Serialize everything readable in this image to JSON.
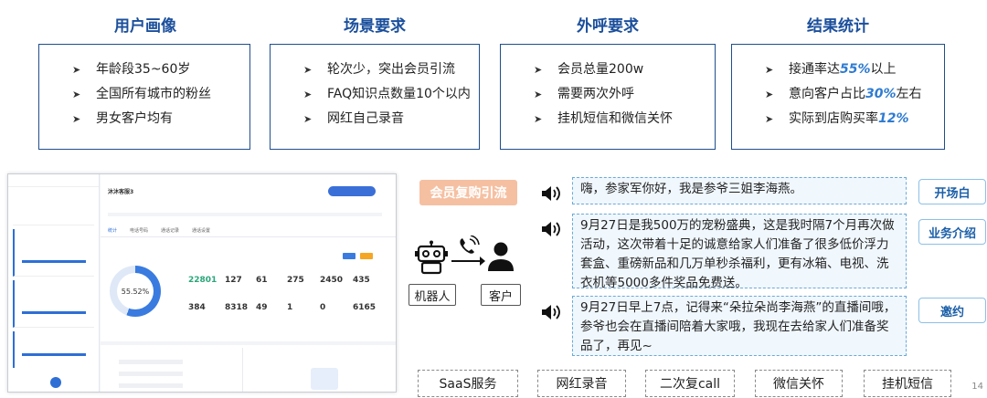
{
  "sections": [
    {
      "title": "用户画像",
      "items": [
        "年龄段35~60岁",
        "全国所有城市的粉丝",
        "男女客户均有"
      ]
    },
    {
      "title": "场景要求",
      "items": [
        "轮次少，突出会员引流",
        "FAQ知识点数量10个以内",
        "网红自己录音"
      ]
    },
    {
      "title": "外呼要求",
      "items": [
        "会员总量200w",
        "需要两次外呼",
        "挂机短信和微信关怀"
      ]
    },
    {
      "title": "结果统计",
      "results": [
        {
          "pre": "接通率达",
          "hl": "55%",
          "post": "以上"
        },
        {
          "pre": "意向客户占比",
          "hl": "30%",
          "post": "左右"
        },
        {
          "pre": "实际到店购买率",
          "hl": "12%",
          "post": ""
        }
      ]
    }
  ],
  "screenshot": {
    "title": "沐沐客服3",
    "percent": "55.52%",
    "tabs": [
      "统计",
      "电话号码",
      "通话记录",
      "通话设置"
    ],
    "stats_row1": [
      "22801",
      "127",
      "61",
      "275",
      "2450",
      "435"
    ],
    "stats_row2": [
      "384",
      "8318",
      "49",
      "1",
      "0",
      "6165"
    ]
  },
  "flow": {
    "button": "会员复购引流",
    "robot_label": "机器人",
    "customer_label": "客户"
  },
  "dialogs": [
    {
      "text": "嗨，参家军你好，我是参爷三姐李海燕。",
      "tag": "开场白"
    },
    {
      "text": "9月27日是我500万的宠粉盛典，这是我时隔7个月再次做活动，这次带着十足的诚意给家人们准备了很多低价浮力套盒、重磅新品和几万单秒杀福利，更有冰箱、电视、洗衣机等5000多件奖品免费送。",
      "tag": "业务介绍"
    },
    {
      "text": "9月27日早上7点，记得来“朵拉朵尚李海燕”的直播间哦，参爷也会在直播间陪着大家哦，我现在去给家人们准备奖品了，再见~",
      "tag": "邀约"
    }
  ],
  "bottom_tags": [
    "SaaS服务",
    "网红录音",
    "二次复call",
    "微信关怀",
    "挂机短信"
  ],
  "page_number": "14",
  "colors": {
    "title": "#1b4f9c",
    "highlight": "#2e7bd1",
    "orange": "#f5c0a2"
  }
}
